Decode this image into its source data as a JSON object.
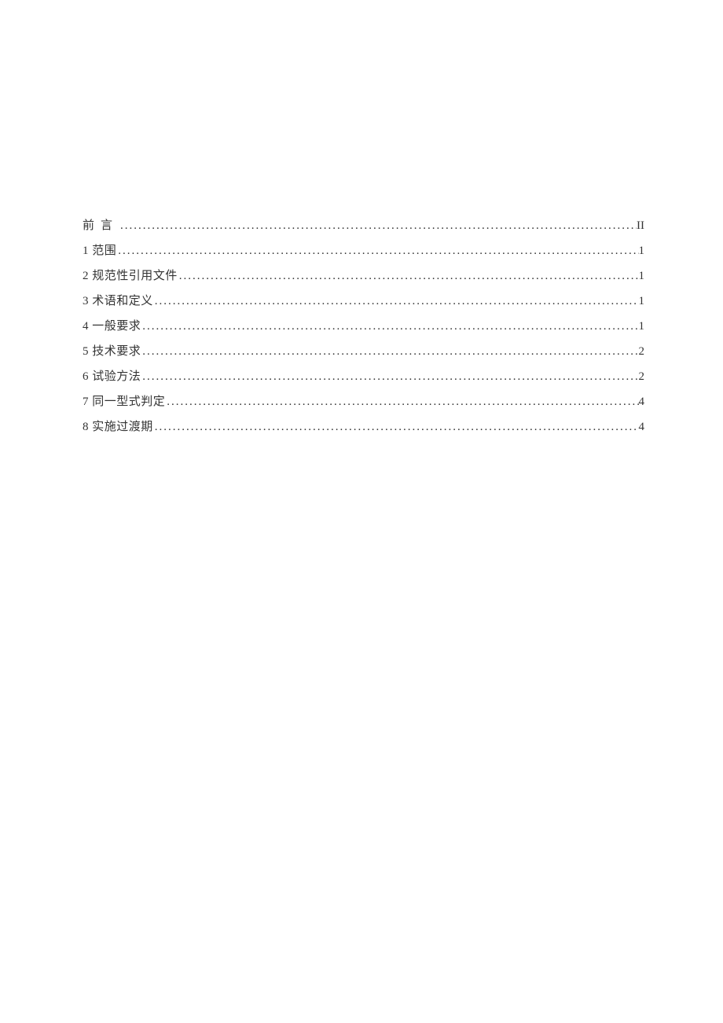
{
  "toc": [
    {
      "label": "前言",
      "page": "II",
      "spaced": true
    },
    {
      "label": "1 范围",
      "page": "1",
      "spaced": false
    },
    {
      "label": "2 规范性引用文件",
      "page": "1",
      "spaced": false
    },
    {
      "label": "3 术语和定义",
      "page": "1",
      "spaced": false
    },
    {
      "label": "4  一般要求",
      "page": "1",
      "spaced": false
    },
    {
      "label": "5 技术要求",
      "page": "2",
      "spaced": false
    },
    {
      "label": "6 试验方法",
      "page": "2",
      "spaced": false
    },
    {
      "label": "7 同一型式判定",
      "page": "4",
      "spaced": false
    },
    {
      "label": "8 实施过渡期",
      "page": "4",
      "spaced": false
    }
  ]
}
